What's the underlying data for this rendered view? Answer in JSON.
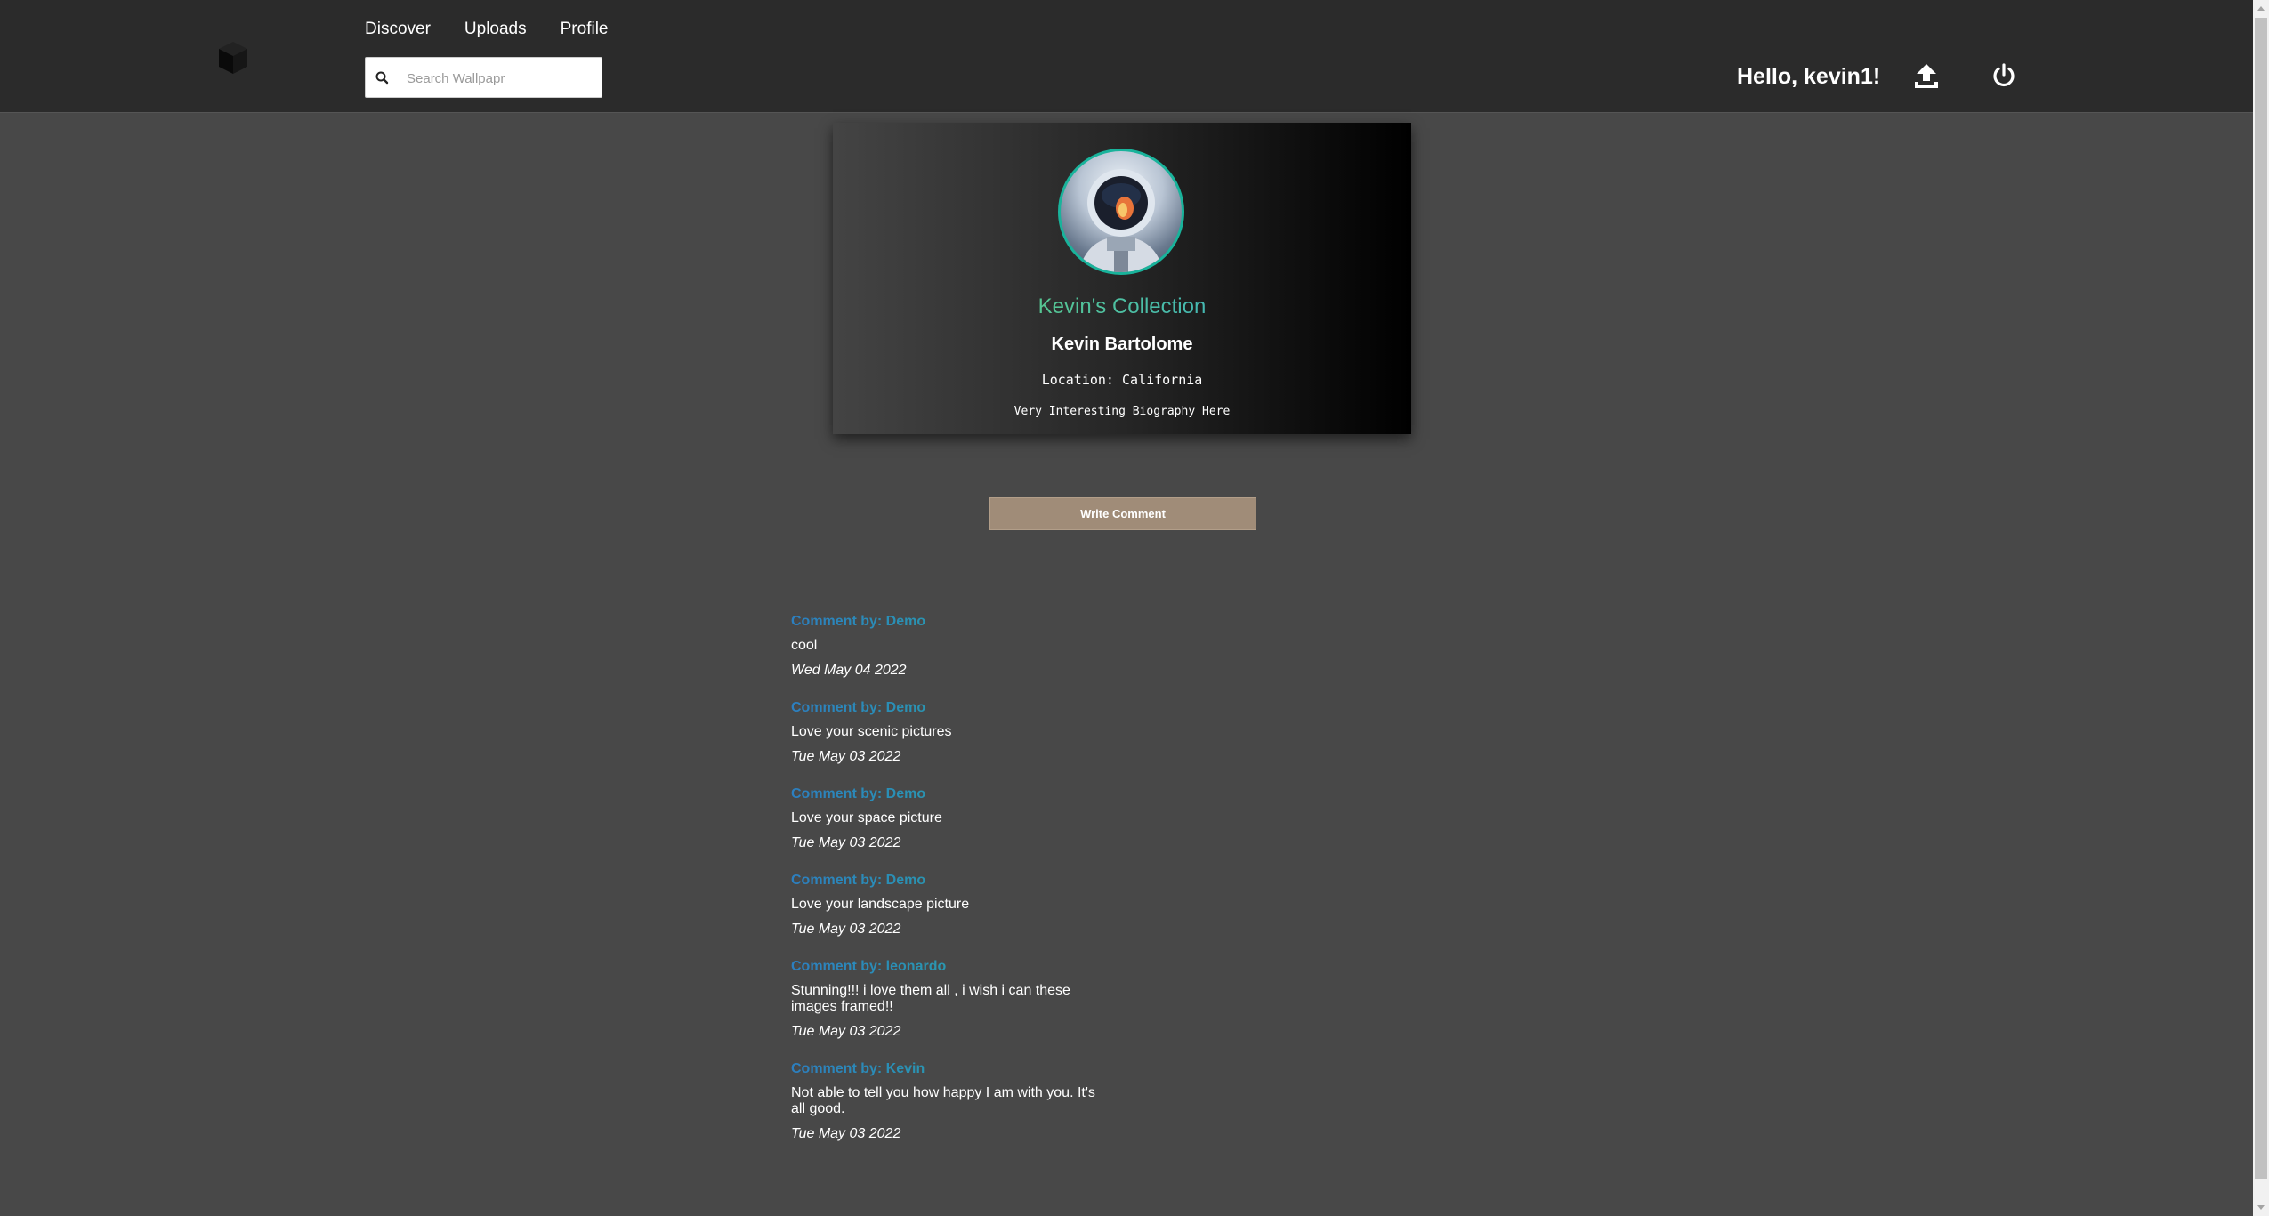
{
  "nav": {
    "links": [
      {
        "label": "Discover"
      },
      {
        "label": "Uploads"
      },
      {
        "label": "Profile"
      }
    ],
    "search_placeholder": "Search Wallpapr",
    "greeting": "Hello, kevin1!",
    "icons": {
      "logo": "cube-logo-icon",
      "search": "search-icon",
      "upload": "upload-icon",
      "logout": "power-icon"
    }
  },
  "profile": {
    "collection_title": "Kevin's Collection",
    "full_name": "Kevin Bartolome",
    "location": "Location: California",
    "bio": "Very Interesting Biography Here",
    "avatar_icon": "astronaut-avatar"
  },
  "write_comment_label": "Write Comment",
  "comments": [
    {
      "by_label": "Comment by: Demo",
      "text": "cool",
      "date": "Wed May 04 2022"
    },
    {
      "by_label": "Comment by: Demo",
      "text": "Love your scenic pictures",
      "date": "Tue May 03 2022"
    },
    {
      "by_label": "Comment by: Demo",
      "text": "Love your space picture",
      "date": "Tue May 03 2022"
    },
    {
      "by_label": "Comment by: Demo",
      "text": "Love your landscape picture",
      "date": "Tue May 03 2022"
    },
    {
      "by_label": "Comment by: leonardo",
      "text": "Stunning!!! i love them all , i wish i can these images framed!!",
      "date": "Tue May 03 2022"
    },
    {
      "by_label": "Comment by: Kevin",
      "text": "Not able to tell you how happy I am with you. It's all good.",
      "date": "Tue May 03 2022"
    }
  ],
  "colors": {
    "navbar": "#2b2b2b",
    "page": "#484848",
    "accent_green": "#6cd66c",
    "accent_blue": "#2fa8d8",
    "button": "#a08c78",
    "avatar_ring": "#19b39b"
  }
}
